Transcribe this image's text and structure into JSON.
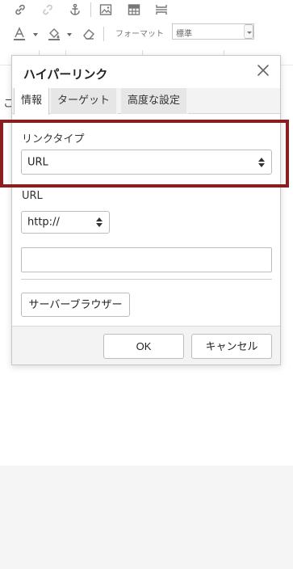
{
  "toolbar": {
    "icons": [
      "link-icon",
      "unlink-icon",
      "anchor-icon",
      "image-icon",
      "table-icon",
      "page-break-icon"
    ],
    "format_label": "フォーマット",
    "format_value": "標準"
  },
  "editor": {
    "ghost_text": "こ"
  },
  "dialog": {
    "title": "ハイパーリンク",
    "tabs": [
      "情報",
      "ターゲット",
      "高度な設定"
    ],
    "link_type_label": "リンクタイプ",
    "link_type_value": "URL",
    "url_label": "URL",
    "protocol_value": "http://",
    "url_value": "",
    "browse_button": "サーバーブラウザー",
    "ok_button": "OK",
    "cancel_button": "キャンセル"
  },
  "colors": {
    "highlight": "#8b1c20",
    "toolbar_icon": "#555555",
    "dialog_footer": "#f3f3f3"
  }
}
